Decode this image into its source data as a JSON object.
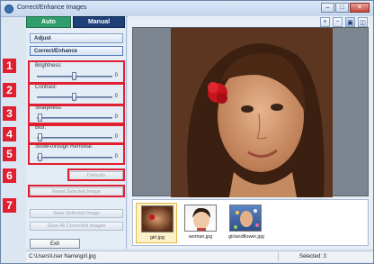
{
  "window": {
    "title": "Correct/Enhance Images"
  },
  "tabs": {
    "auto": "Auto",
    "manual": "Manual"
  },
  "modes": {
    "adjust": "Adjust",
    "correct_enhance": "Correct/Enhance"
  },
  "sliders": [
    {
      "label": "Brightness:",
      "value": "0"
    },
    {
      "label": "Contrast:",
      "value": "0"
    },
    {
      "label": "Sharpness:",
      "value": "0"
    },
    {
      "label": "Blur:",
      "value": "0"
    },
    {
      "label": "Show-through Removal:",
      "value": "0"
    }
  ],
  "buttons": {
    "defaults": "Defaults",
    "reset_selected": "Reset Selected Image",
    "save_selected": "Save Selected Image",
    "save_all": "Save All Corrected Images",
    "exit": "Exit"
  },
  "callouts": [
    "1",
    "2",
    "3",
    "4",
    "5",
    "6",
    "7"
  ],
  "thumbnails": [
    {
      "name": "girl.jpg",
      "selected": true
    },
    {
      "name": "woman.jpg",
      "selected": false
    },
    {
      "name": "girlandflower.jpg",
      "selected": false
    }
  ],
  "status": {
    "path": "C:\\Users\\User Name\\girl.jpg",
    "selected": "Selected: 3"
  },
  "colors": {
    "auto_tab": "#2f9d6c",
    "manual_tab": "#1e3f78",
    "callout": "#e02030"
  },
  "icons": {
    "zoom_in": "zoom-in-icon",
    "zoom_out": "zoom-out-icon",
    "single_view": "single-view-icon",
    "compare_view": "compare-view-icon"
  }
}
